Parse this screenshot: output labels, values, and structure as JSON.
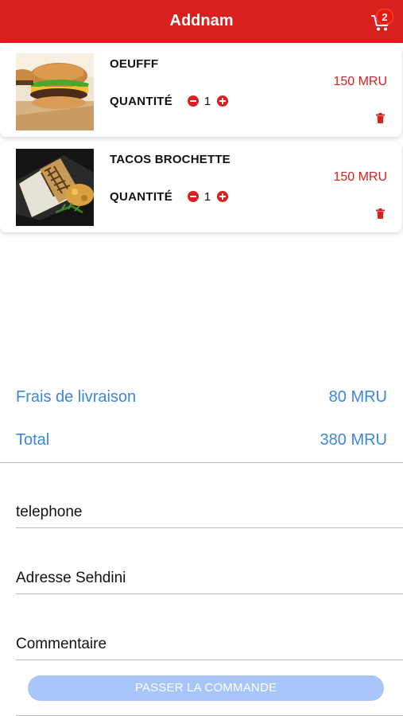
{
  "header": {
    "title": "Addnam",
    "cart_icon": "cart-icon",
    "cart_count": "2",
    "color": "#d8211f"
  },
  "cart_items": [
    {
      "name": "OEUFFF",
      "quantity_label": "QUANTITÉ",
      "quantity": "1",
      "price": "150 MRU",
      "image": "burger-image"
    },
    {
      "name": "TACOS BROCHETTE",
      "quantity_label": "QUANTITÉ",
      "quantity": "1",
      "price": "150 MRU",
      "image": "tacos-image"
    }
  ],
  "summary": {
    "delivery_label": "Frais de livraison",
    "delivery_value": "80 MRU",
    "total_label": "Total",
    "total_value": "380 MRU",
    "color": "#3b86e0"
  },
  "form": {
    "phone_placeholder": "telephone",
    "address_placeholder": "Adresse Sehdini",
    "comment_placeholder": "Commentaire",
    "submit_label": "PASSER LA COMMANDE"
  }
}
